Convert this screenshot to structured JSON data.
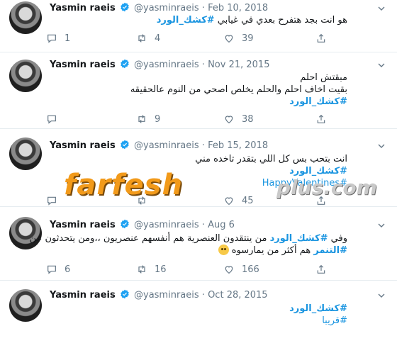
{
  "tweets": [
    {
      "name": "Yasmin raeis",
      "handle": "@yasminraeis",
      "sep": "·",
      "date": "Feb 10, 2018",
      "lines": [
        {
          "text": "هو انت بجد هتفرح بعدي في غيابي ",
          "hashtag": "#كشك_الورد"
        }
      ],
      "reply": "1",
      "retweet": "4",
      "like": "39"
    },
    {
      "name": "Yasmin raeis",
      "handle": "@yasminraeis",
      "sep": "·",
      "date": "Nov 21, 2015",
      "lines": [
        {
          "text": "مبقتش احلم",
          "hashtag": ""
        },
        {
          "text": "بقيت اخاف احلم والحلم يخلص اصحي من النوم عالحقيقه",
          "hashtag": ""
        },
        {
          "text": "",
          "hashtag": "#كشك_الورد"
        }
      ],
      "reply": "",
      "retweet": "9",
      "like": "38"
    },
    {
      "name": "Yasmin raeis",
      "handle": "@yasminraeis",
      "sep": "·",
      "date": "Feb 15, 2018",
      "lines": [
        {
          "text": "انت بتحب بس كل اللي بتقدر تاخده مني",
          "hashtag": ""
        },
        {
          "text": "",
          "hashtag": "#كشك_الورد"
        },
        {
          "text": "",
          "hashtag": "#HappyValentines"
        }
      ],
      "reply": "",
      "retweet": "",
      "like": "45"
    },
    {
      "name": "Yasmin raeis",
      "handle": "@yasminraeis",
      "sep": "·",
      "date": "Aug 6",
      "line1_pre": "وفي ",
      "line1_hash": "#كشك_الورد",
      "line1_post": " من ينتقدون العنصرية هم أنفسهم عنصريون ،،ومن يتحدثون عن",
      "line2_hash": "#التنمر",
      "line2_post": " هم أكثر من يمارسوه",
      "reply": "6",
      "retweet": "16",
      "like": "166"
    },
    {
      "name": "Yasmin raeis",
      "handle": "@yasminraeis",
      "sep": "·",
      "date": "Oct 28, 2015",
      "lines": [
        {
          "text": "",
          "hashtag": "#كشك_الورد"
        },
        {
          "text": "",
          "hashtag": "#قريبا"
        }
      ],
      "reply": "",
      "retweet": "",
      "like": ""
    }
  ],
  "watermark": {
    "brand": "farfesh",
    "suffix": "plus.com"
  },
  "icons": {
    "reply": "reply-icon",
    "retweet": "retweet-icon",
    "like": "like-icon",
    "share": "share-icon",
    "more": "chevron-down-icon",
    "verified": "verified-badge-icon"
  },
  "colors": {
    "link": "#1b95e0",
    "muted": "#657786",
    "verified": "#1da1f2"
  }
}
